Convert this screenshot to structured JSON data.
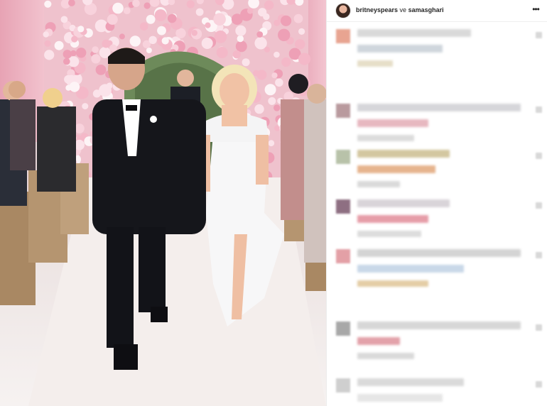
{
  "post": {
    "username_primary": "britneyspears",
    "conjunction": "ve",
    "username_secondary": "samasghari",
    "more_icon": "more-horizontal-icon"
  },
  "photo": {
    "description_icon": "wedding-photo",
    "colors": {
      "floral_pink": "#f0c3cf",
      "aisle": "#efe7e6",
      "tuxedo": "#15161b",
      "dress": "#f7f7f8"
    }
  },
  "comments": [
    {
      "avatar_color": "#e8a491",
      "line_colors": [
        "#d9d9d9",
        "#cfd6dd",
        "#e6dfc8"
      ],
      "pixelated": true
    },
    {
      "avatar_color": "#b99a9e",
      "line_colors": [
        "#d6d6da",
        "#e7b8c0",
        "#dcdcdc"
      ],
      "pixelated": true
    },
    {
      "avatar_color": "#b8c2a9",
      "line_colors": [
        "#d3c7a0",
        "#e6b48e",
        "#dadada"
      ],
      "pixelated": true
    },
    {
      "avatar_color": "#8e6f82",
      "line_colors": [
        "#d9d4d9",
        "#e69da8",
        "#dddddd"
      ],
      "pixelated": true
    },
    {
      "avatar_color": "#e3a0a6",
      "line_colors": [
        "#d4d4d4",
        "#c9d8e8",
        "#e4cda6"
      ],
      "pixelated": true
    },
    {
      "avatar_color": "#a8a8a8",
      "line_colors": [
        "#d7d7d7",
        "#e3a2aa",
        "#dadada"
      ],
      "pixelated": true
    },
    {
      "avatar_color": "#cfcfcf",
      "line_colors": [
        "#dadada",
        "#e6e6e6",
        "#e9e9e9"
      ],
      "pixelated": true
    }
  ]
}
